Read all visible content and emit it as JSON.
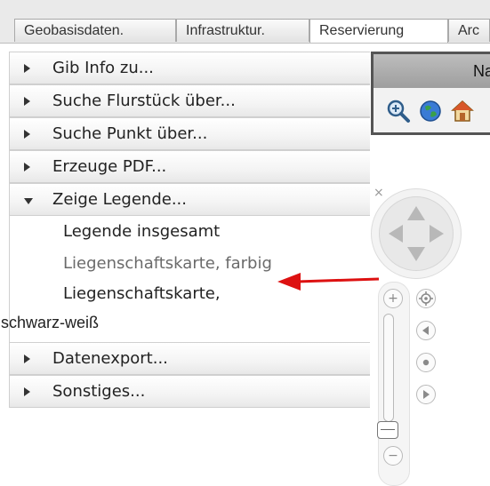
{
  "tabs": [
    {
      "label": "Geobasisdaten."
    },
    {
      "label": "Infrastruktur."
    },
    {
      "label": "Reservierung"
    },
    {
      "label": "Arc"
    }
  ],
  "accordion": {
    "items": [
      {
        "label": "Gib Info zu..."
      },
      {
        "label": "Suche Flurstück über..."
      },
      {
        "label": "Suche Punkt über..."
      },
      {
        "label": "Erzeuge PDF..."
      },
      {
        "label": "Zeige Legende..."
      },
      {
        "label": "Datenexport..."
      },
      {
        "label": "Sonstiges..."
      }
    ],
    "legend_links": [
      {
        "label": "Legende insgesamt"
      },
      {
        "label": "Liegenschaftskarte, farbig"
      },
      {
        "label_line1": "Liegenschaftskarte,",
        "label_line2": "schwarz-weiß"
      }
    ]
  },
  "toolbar": {
    "title": "Na",
    "icons": [
      "zoom-in-icon",
      "globe-icon",
      "home-icon"
    ]
  },
  "navigation": {
    "close_symbol": "×",
    "zoom_in_symbol": "+",
    "zoom_out_symbol": "−",
    "icons": [
      "pan-up-icon",
      "pan-down-icon",
      "pan-left-icon",
      "pan-right-icon",
      "center-icon",
      "history-back-icon",
      "dot-icon",
      "history-forward-icon"
    ]
  },
  "colors": {
    "arrow": "#dd1111",
    "tab_bar": "#eaeaea",
    "toolbar_title": "#a8a8a8"
  }
}
